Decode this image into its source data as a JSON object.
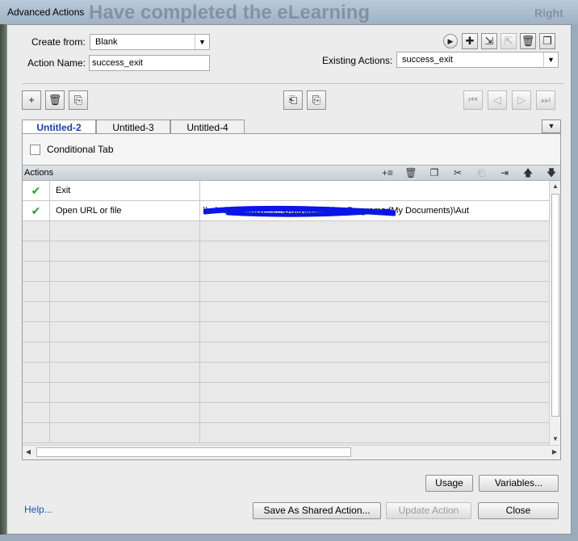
{
  "window": {
    "title": "Advanced Actions",
    "background_text_1": "Have completed the eLearning",
    "background_text_2": "Right"
  },
  "top": {
    "create_from_label": "Create from:",
    "create_from_value": "Blank",
    "action_name_label": "Action Name:",
    "action_name_value": "success_exit",
    "existing_actions_label": "Existing Actions:",
    "existing_actions_value": "success_exit"
  },
  "tabs": [
    "Untitled-2",
    "Untitled-3",
    "Untitled-4"
  ],
  "conditional_tab_label": "Conditional Tab",
  "actions_header": "Actions",
  "rows": [
    {
      "status": "✔",
      "action": "Exit",
      "target": ""
    },
    {
      "status": "✔",
      "action": "Open URL or file",
      "target": "\\\\...\\...\\WORKS\\...\\...\\Data\\eLearning Programs (My Documents)\\Aut"
    }
  ],
  "buttons": {
    "usage": "Usage",
    "variables": "Variables...",
    "help": "Help...",
    "save_shared": "Save As Shared Action...",
    "update": "Update Action",
    "close": "Close"
  },
  "colors": {
    "accent": "#1a3fa8",
    "check": "#2f9a2f",
    "redaction": "#0a16e8"
  }
}
